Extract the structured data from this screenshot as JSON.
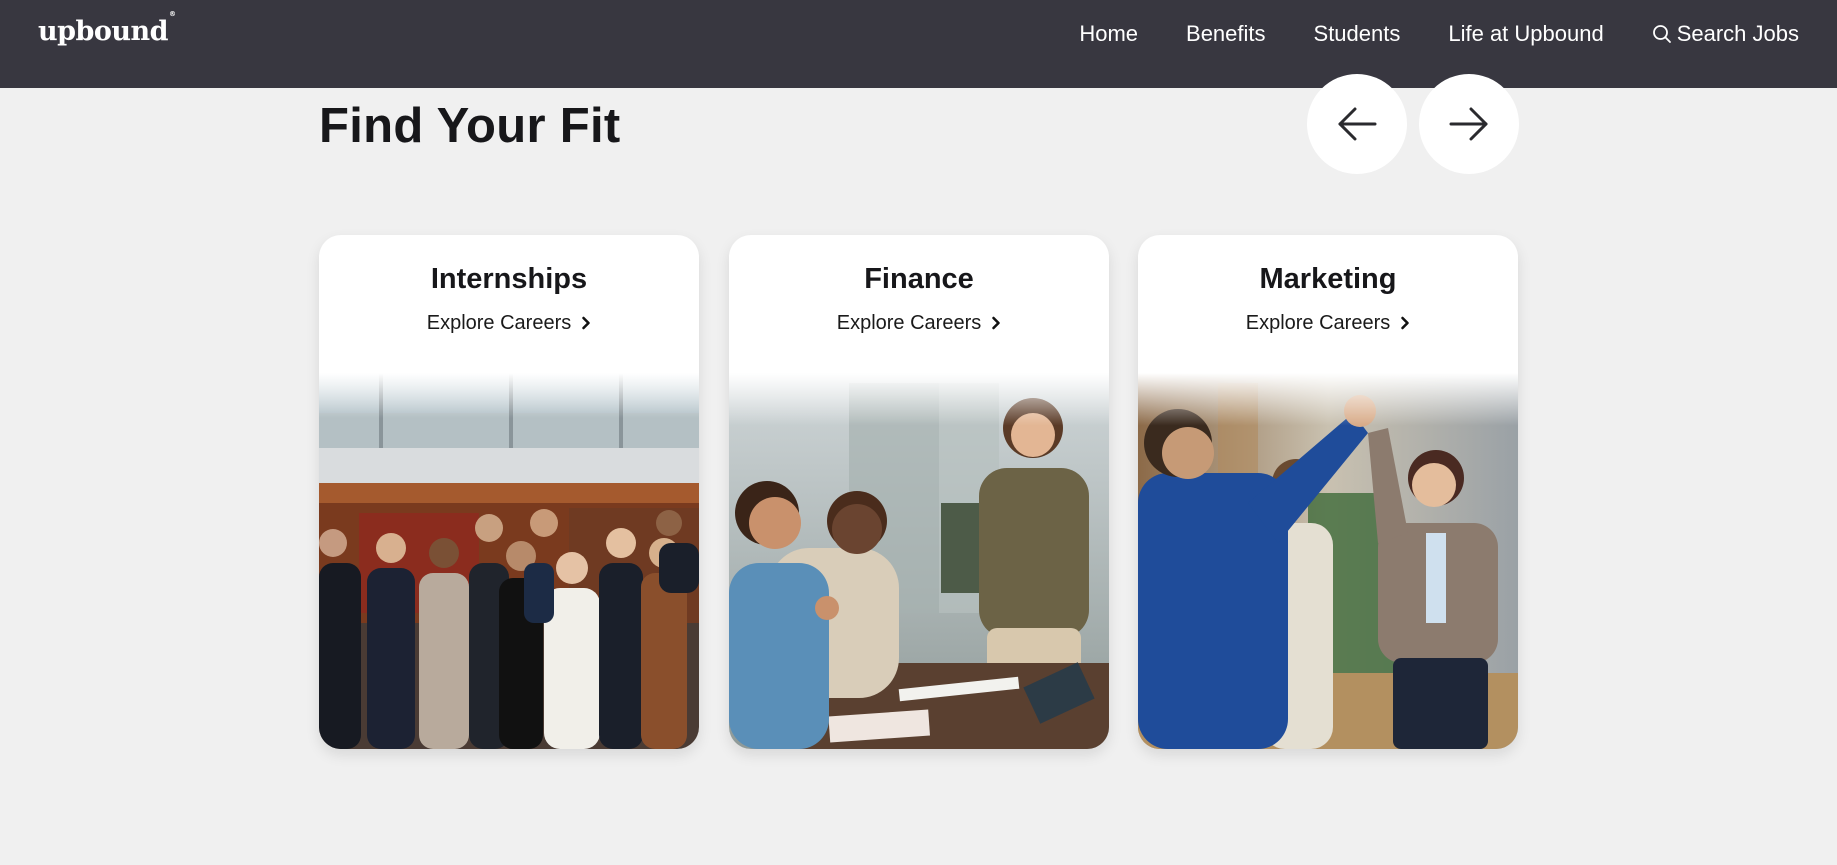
{
  "header": {
    "logo": "upbound",
    "logo_mark": "®",
    "nav": [
      {
        "label": "Home",
        "icon": null
      },
      {
        "label": "Benefits",
        "icon": null
      },
      {
        "label": "Students",
        "icon": null
      },
      {
        "label": "Life at Upbound",
        "icon": null
      },
      {
        "label": "Search Jobs",
        "icon": "search-icon"
      }
    ],
    "background": "#383740"
  },
  "section": {
    "title": "Find Your Fit",
    "prev_icon": "arrow-left-icon",
    "next_icon": "arrow-right-icon"
  },
  "cards": [
    {
      "title": "Internships",
      "link": "Explore Careers",
      "link_icon": "chevron-right-icon",
      "photo": "group-of-interns-photo"
    },
    {
      "title": "Finance",
      "link": "Explore Careers",
      "link_icon": "chevron-right-icon",
      "photo": "team-meeting-photo"
    },
    {
      "title": "Marketing",
      "link": "Explore Careers",
      "link_icon": "chevron-right-icon",
      "photo": "high-five-photo"
    }
  ],
  "colors": {
    "page_background": "#f0f0f0",
    "card_background": "#ffffff",
    "text_dark": "#17171a"
  }
}
